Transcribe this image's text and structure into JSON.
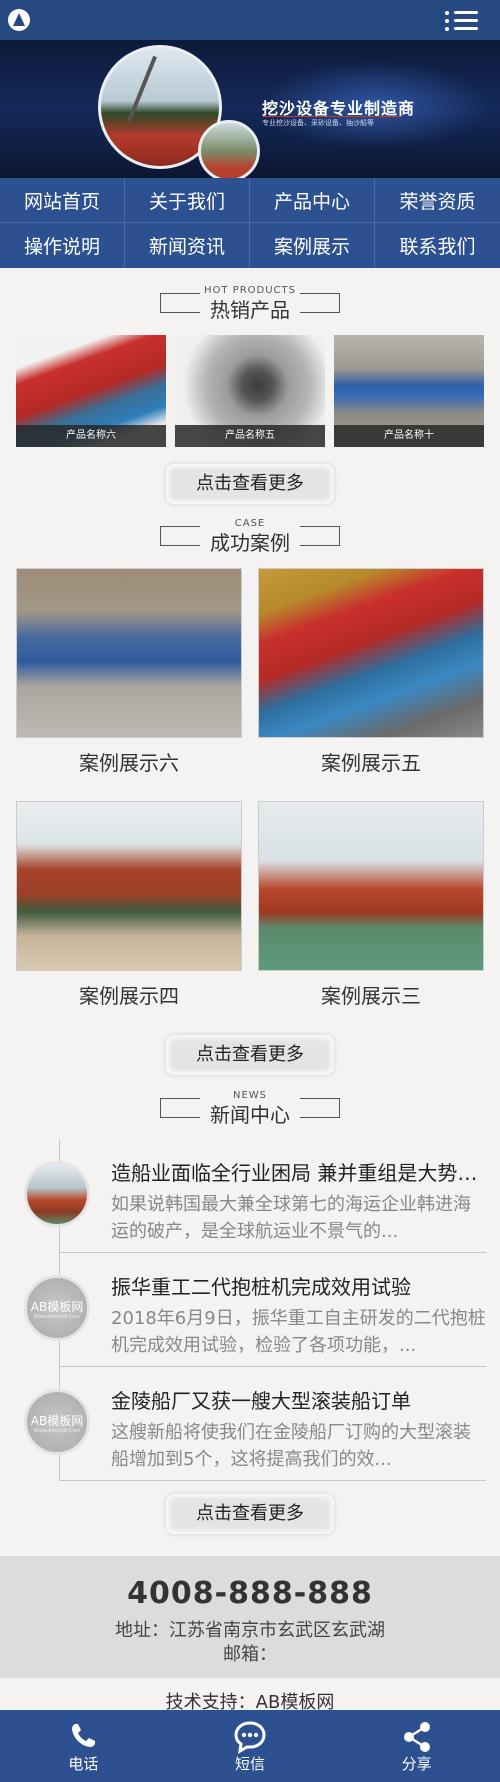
{
  "header": {
    "logo_icon": "logo-icon",
    "menu_icon": "menu-icon"
  },
  "banner": {
    "slogan": "挖沙设备专业制造商",
    "slogan_sub": "专业挖沙设备、采砂设备、抽沙船等"
  },
  "nav": {
    "items": [
      {
        "label": "网站首页"
      },
      {
        "label": "关于我们"
      },
      {
        "label": "产品中心"
      },
      {
        "label": "荣誉资质"
      },
      {
        "label": "操作说明"
      },
      {
        "label": "新闻资讯"
      },
      {
        "label": "案例展示"
      },
      {
        "label": "联系我们"
      }
    ]
  },
  "hot_products": {
    "title_en": "HOT PRODUCTS",
    "title_cn": "热销产品",
    "items": [
      {
        "caption": "产品名称六"
      },
      {
        "caption": "产品名称五"
      },
      {
        "caption": "产品名称十"
      }
    ],
    "more_label": "点击查看更多"
  },
  "cases": {
    "title_en": "CASE",
    "title_cn": "成功案例",
    "items": [
      {
        "title": "案例展示六"
      },
      {
        "title": "案例展示五"
      },
      {
        "title": "案例展示四"
      },
      {
        "title": "案例展示三"
      }
    ],
    "more_label": "点击查看更多"
  },
  "news": {
    "title_en": "NEWS",
    "title_cn": "新闻中心",
    "items": [
      {
        "title": "造船业面临全行业困局 兼并重组是大势所趋",
        "desc": "如果说韩国最大兼全球第七的海运企业韩进海运的破产，是全球航运业不景气的..."
      },
      {
        "title": "振华重工二代抱桩机完成效用试验",
        "desc": "2018年6月9日，振华重工自主研发的二代抱桩机完成效用试验，检验了各项功能，..."
      },
      {
        "title": "金陵船厂又获一艘大型滚装船订单",
        "desc": "这艘新船将使我们在金陵船厂订购的大型滚装船增加到5个，这将提高我们的效..."
      }
    ],
    "thumb_ab_text": "AB模板网",
    "thumb_ab_sub": "Www.Admin8.Com",
    "more_label": "点击查看更多"
  },
  "footer": {
    "phone": "4008-888-888",
    "address": "地址：江苏省南京市玄武区玄武湖",
    "email": "邮箱：",
    "support": "技术支持：AB模板网"
  },
  "bottom_bar": {
    "items": [
      {
        "label": "电话",
        "icon": "phone-icon"
      },
      {
        "label": "短信",
        "icon": "message-icon"
      },
      {
        "label": "分享",
        "icon": "share-icon"
      }
    ]
  },
  "colors": {
    "primary": "#2d5190",
    "header": "#26497f",
    "background": "#f4f3f1"
  }
}
